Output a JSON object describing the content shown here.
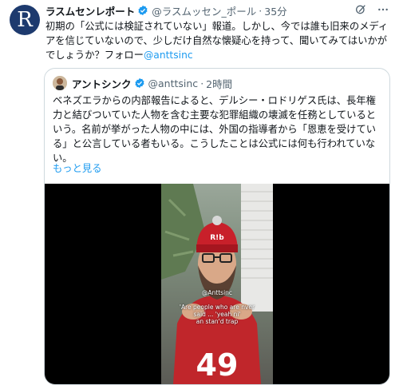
{
  "tweet": {
    "avatar_letter": "R",
    "name": "ラスムセンレポート",
    "handle": "@ラスムッセン_ポール",
    "separator": "·",
    "time": "35分",
    "text": "初期の「公式には検証されていない」報道。しかし、今では誰も旧来のメディアを信じていないので、少しだけ自然な懐疑心を持って、聞いてみてはいかがでしょうか？フォロー",
    "mention": "@anttsinc"
  },
  "quote": {
    "name": "アントシンク",
    "handle": "@anttsinc",
    "separator": "·",
    "time": "2時間",
    "text": "ベネズエラからの内部報告によると、デルシー・ロドリゲス氏は、長年権力と結びついていた人物を含む主要な犯罪組織の壊滅を任務としているという。名前が挙がった人物の中には、外国の指導者から「恩恵を受けている」と公言している者もいる。こうしたことは公式には何も行われていない。",
    "more_label": "もっと見る",
    "video": {
      "overlay_handle": "@Anttsinc",
      "overlay_caption": "'Are people who are nver\nsaid ... 'yeah ni'\nan stan'd trap",
      "subtitle": "R!b",
      "cap_text": "49"
    }
  },
  "colors": {
    "accent": "#1d9bf0",
    "verified": "#1d9bf0",
    "text": "#0f1419",
    "muted": "#536471"
  }
}
